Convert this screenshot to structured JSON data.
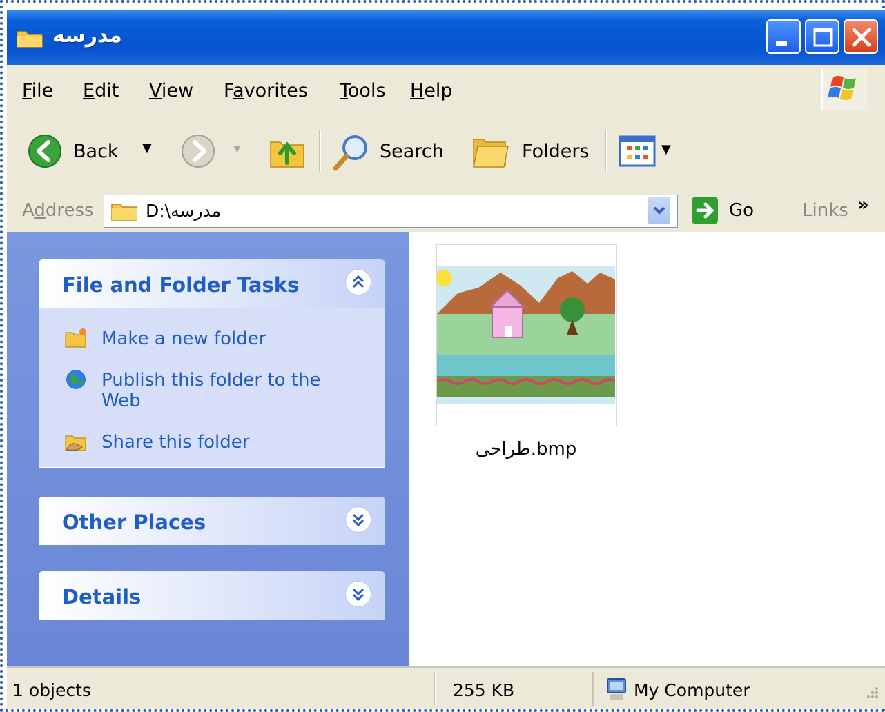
{
  "window": {
    "title": "مدرسه"
  },
  "menu": {
    "items": [
      {
        "pre": "",
        "key": "F",
        "rest": "ile"
      },
      {
        "pre": "",
        "key": "E",
        "rest": "dit"
      },
      {
        "pre": "",
        "key": "V",
        "rest": "iew"
      },
      {
        "pre": "F",
        "key": "a",
        "rest": "vorites"
      },
      {
        "pre": "",
        "key": "T",
        "rest": "ools"
      },
      {
        "pre": "",
        "key": "H",
        "rest": "elp"
      }
    ]
  },
  "toolbar": {
    "back_label": "Back",
    "search_label": "Search",
    "folders_label": "Folders"
  },
  "address": {
    "label_pre": "A",
    "label_key": "d",
    "label_rest": "dress",
    "path": "D:\\مدرسه",
    "go_label": "Go",
    "links_label": "Links"
  },
  "taskpane": {
    "file_folder_tasks": {
      "title": "File and Folder Tasks",
      "items": [
        {
          "label": "Make a new folder",
          "icon": "new-folder-icon"
        },
        {
          "label": "Publish this folder to the Web",
          "icon": "globe-icon"
        },
        {
          "label": "Share this folder",
          "icon": "share-folder-icon"
        }
      ]
    },
    "other_places": {
      "title": "Other Places"
    },
    "details": {
      "title": "Details"
    }
  },
  "files": [
    {
      "name": "طراحی.bmp",
      "icon": "landscape-thumbnail"
    }
  ],
  "status": {
    "objects": "1 objects",
    "size": "255 KB",
    "location": "My Computer"
  },
  "colors": {
    "title_blue": "#0553cf",
    "task_blue": "#215dc6",
    "pane_bg": "#7a98df",
    "close_red": "#d4401b"
  }
}
